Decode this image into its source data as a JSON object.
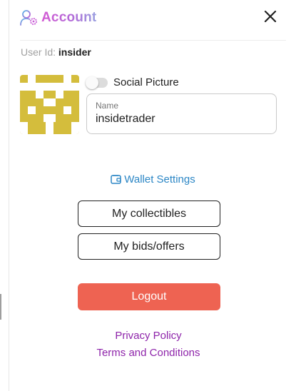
{
  "header": {
    "title": "Account",
    "icon": "user-gear-icon",
    "close_icon": "close-icon",
    "title_gradient": [
      "#d35ad3",
      "#9aa0e0"
    ]
  },
  "user": {
    "id_label": "User Id:",
    "id_value": "insider"
  },
  "avatar": {
    "icon": "identicon",
    "color": "#d4bd3c"
  },
  "social_picture": {
    "label": "Social Picture",
    "enabled": false
  },
  "name_field": {
    "label": "Name",
    "value": "insidetrader"
  },
  "wallet": {
    "label": "Wallet Settings",
    "icon": "wallet-icon",
    "color": "#2b86c5"
  },
  "buttons": {
    "collectibles": "My collectibles",
    "bids": "My bids/offers",
    "logout": "Logout",
    "logout_color": "#ee6352"
  },
  "links": {
    "privacy": "Privacy Policy",
    "terms": "Terms and Conditions",
    "color": "#8e24aa"
  }
}
